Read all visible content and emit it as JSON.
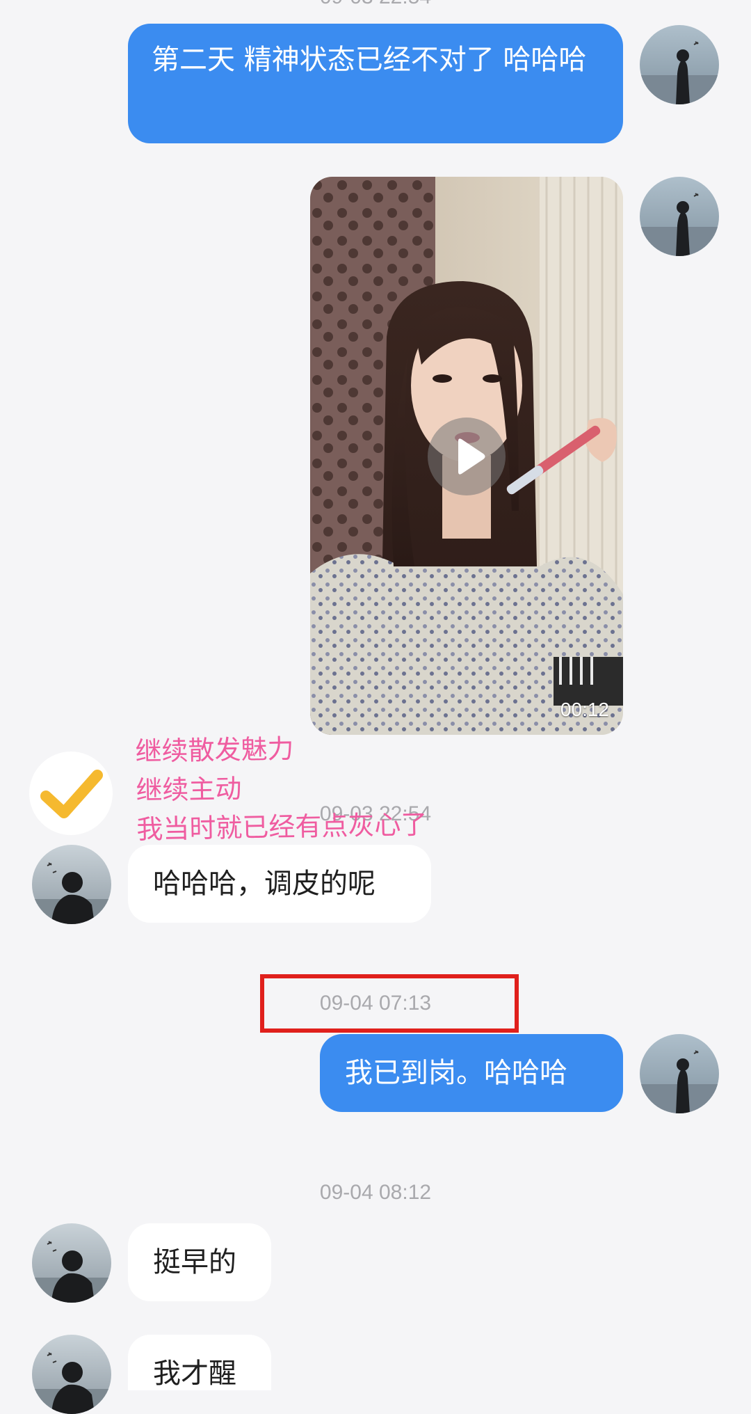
{
  "chat": {
    "timestamps": {
      "t1": "09-03 22:54",
      "t2": "09-04 07:13",
      "t3": "09-04 08:12"
    },
    "messages": {
      "sent_1": "第二天 精神状态已经不对了 哈哈哈",
      "recv_1": "哈哈哈，调皮的呢",
      "sent_2": "我已到岗。哈哈哈",
      "recv_2": "挺早的",
      "recv_3": "我才醒"
    },
    "video": {
      "duration": "00:12",
      "play_icon": "play-icon"
    }
  },
  "annotation": {
    "lines": [
      "继续散发魅力",
      "继续主动",
      "我当时就已经有点灰心了"
    ],
    "check_icon": "checkmark-icon",
    "color": "#ef5ca0",
    "highlight_color": "#e0201c"
  },
  "colors": {
    "background": "#f5f5f7",
    "sent_bubble": "#3b8cf0",
    "recv_bubble": "#ffffff",
    "timestamp": "#a9a9ad"
  }
}
